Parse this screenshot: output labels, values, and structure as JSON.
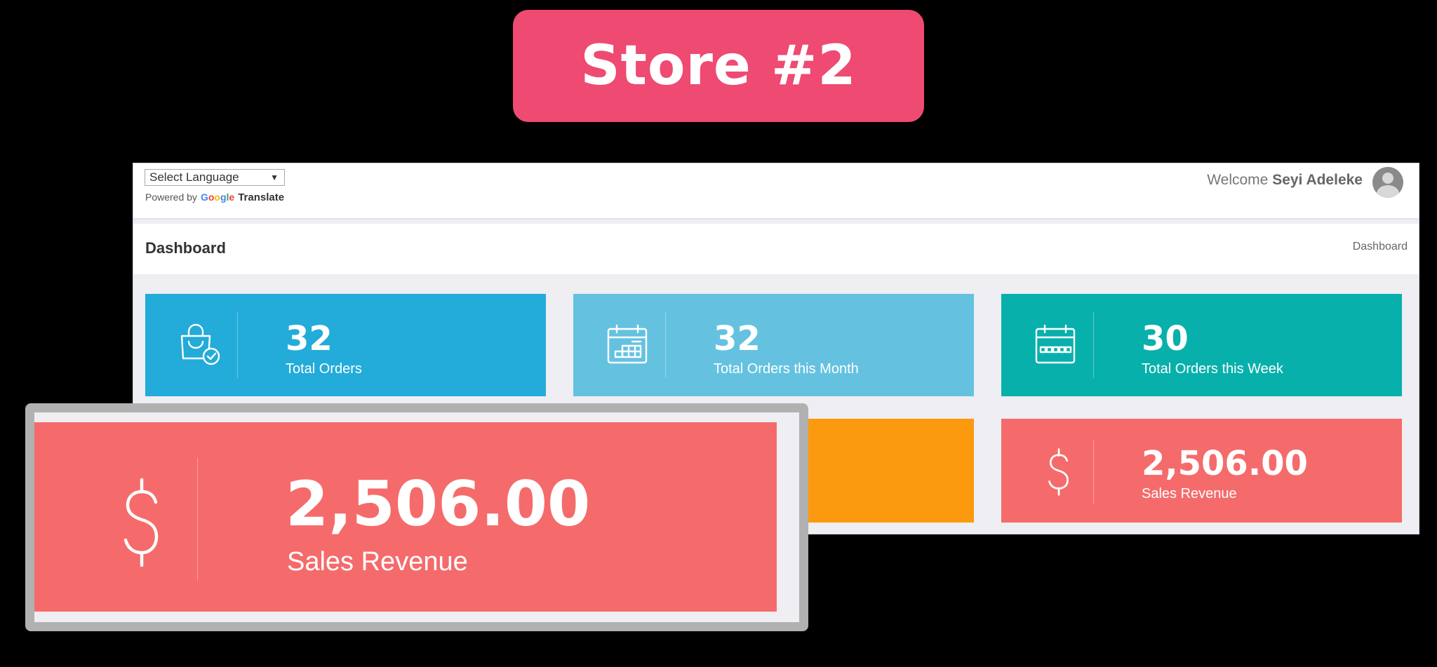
{
  "banner": {
    "title": "Store #2",
    "color": "#ee4a72"
  },
  "topbar": {
    "language_select": "Select Language",
    "powered_by": "Powered by",
    "google": [
      "G",
      "o",
      "o",
      "g",
      "l",
      "e"
    ],
    "translate": "Translate",
    "welcome_prefix": "Welcome",
    "user_name": "Seyi Adeleke"
  },
  "page": {
    "title": "Dashboard",
    "breadcrumb": "Dashboard"
  },
  "cards": [
    {
      "value": "32",
      "label": "Total Orders",
      "icon": "shopping-bag-check-icon",
      "color": "#23abd9"
    },
    {
      "value": "32",
      "label": "Total Orders this Month",
      "icon": "calendar-month-icon",
      "color": "#64c2e0"
    },
    {
      "value": "30",
      "label": "Total Orders this Week",
      "icon": "calendar-week-icon",
      "color": "#08b0ac"
    },
    {
      "value": "",
      "label": "",
      "icon": "",
      "color": "#fb9a0e"
    },
    {
      "value": "2,506.00",
      "label": "Sales Revenue",
      "icon": "dollar-icon",
      "color": "#f56b6b"
    }
  ],
  "zoom_card": {
    "value": "2,506.00",
    "label": "Sales Revenue",
    "icon": "dollar-icon",
    "color": "#f56b6b"
  }
}
